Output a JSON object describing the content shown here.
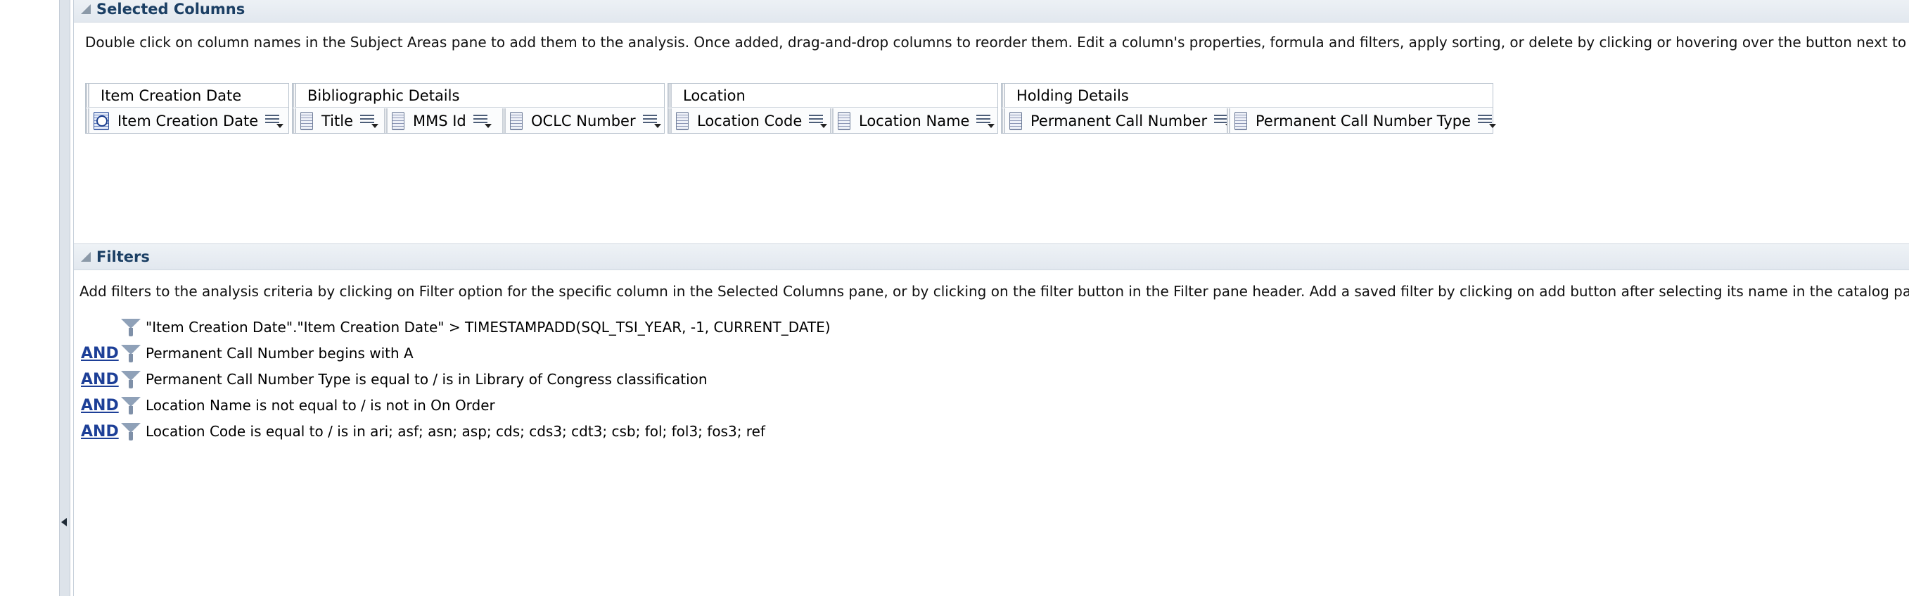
{
  "selected_columns": {
    "title": "Selected Columns",
    "instructions": "Double click on column names in the Subject Areas pane to add them to the analysis. Once added, drag-and-drop columns to reorder them. Edit a column's properties, formula and filters, apply sorting, or delete by clicking or hovering over the button next to its name",
    "groups": [
      {
        "label": "Item Creation Date",
        "columns": [
          {
            "label": "Item Creation Date",
            "icon": "date-column-icon"
          }
        ]
      },
      {
        "label": "Bibliographic Details",
        "columns": [
          {
            "label": "Title",
            "icon": "attribute-column-icon"
          },
          {
            "label": "MMS Id",
            "icon": "attribute-column-icon"
          },
          {
            "label": "OCLC Number",
            "icon": "attribute-column-icon"
          }
        ]
      },
      {
        "label": "Location",
        "columns": [
          {
            "label": "Location Code",
            "icon": "attribute-column-icon"
          },
          {
            "label": "Location Name",
            "icon": "attribute-column-icon"
          }
        ]
      },
      {
        "label": "Holding Details",
        "columns": [
          {
            "label": "Permanent Call Number",
            "icon": "attribute-column-icon"
          },
          {
            "label": "Permanent Call Number Type",
            "icon": "attribute-column-icon"
          }
        ]
      }
    ]
  },
  "filters": {
    "title": "Filters",
    "instructions": "Add filters to the analysis criteria by clicking on Filter option for the specific column in the Selected Columns pane, or by clicking on the filter button in the Filter pane header. Add a saved filter by clicking on add button after selecting its name in the catalog pane.",
    "items": [
      {
        "operator": "",
        "text": "\"Item Creation Date\".\"Item Creation Date\" > TIMESTAMPADD(SQL_TSI_YEAR, -1, CURRENT_DATE)"
      },
      {
        "operator": "AND",
        "text": "Permanent Call Number  begins with A"
      },
      {
        "operator": "AND",
        "text": "Permanent Call Number Type is equal to / is in  Library of Congress classification"
      },
      {
        "operator": "AND",
        "text": "Location Name is not equal to / is not in  On Order"
      },
      {
        "operator": "AND",
        "text": "Location Code is equal to / is in  ari; asf; asn; asp; cds; cds3; cdt3; csb; fol; fol3; fos3; ref"
      }
    ]
  }
}
